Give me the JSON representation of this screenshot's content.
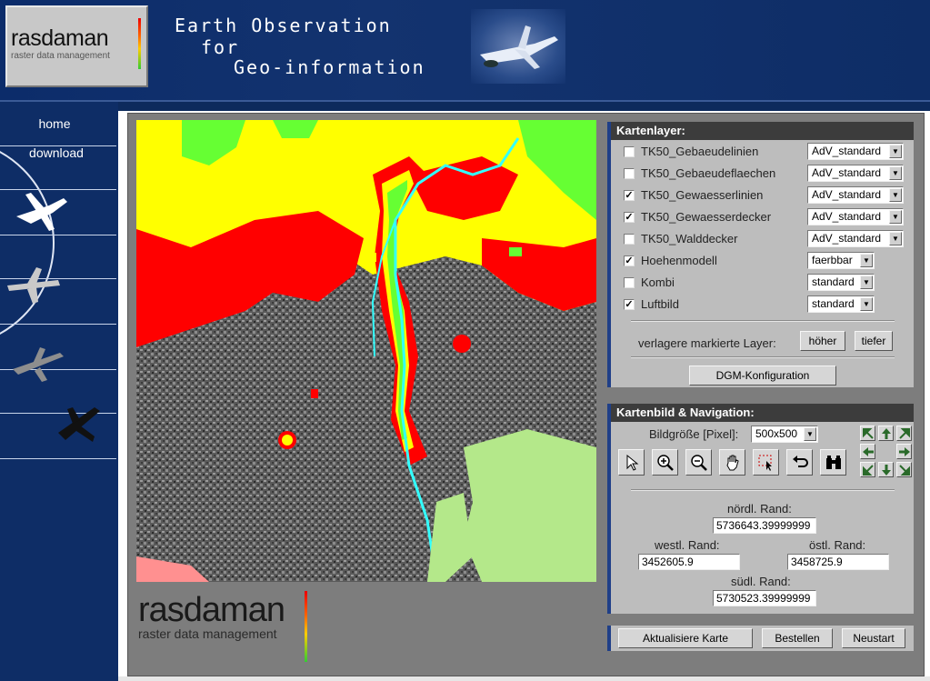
{
  "header": {
    "logo_word": "rasdaman",
    "logo_sub": "raster data management",
    "title_line1": "Earth Observation",
    "title_line2": "for",
    "title_line3": "Geo-information"
  },
  "nav": {
    "home": "home",
    "download": "download"
  },
  "footer_logo": {
    "word": "rasdaman",
    "sub": "raster data management"
  },
  "layers_panel": {
    "title": "Kartenlayer:",
    "layers": [
      {
        "label": "TK50_Gebaeudelinien",
        "checked": false,
        "style": "AdV_standard"
      },
      {
        "label": "TK50_Gebaeudeflaechen",
        "checked": false,
        "style": "AdV_standard"
      },
      {
        "label": "TK50_Gewaesserlinien",
        "checked": true,
        "style": "AdV_standard"
      },
      {
        "label": "TK50_Gewaesserdecker",
        "checked": true,
        "style": "AdV_standard"
      },
      {
        "label": "TK50_Walddecker",
        "checked": false,
        "style": "AdV_standard"
      },
      {
        "label": "Hoehenmodell",
        "checked": true,
        "style": "faerbbar"
      },
      {
        "label": "Kombi",
        "checked": false,
        "style": "standard"
      },
      {
        "label": "Luftbild",
        "checked": true,
        "style": "standard"
      }
    ],
    "move_label": "verlagere markierte Layer:",
    "higher": "höher",
    "lower": "tiefer",
    "dgm_button": "DGM-Konfiguration"
  },
  "nav_panel": {
    "title": "Kartenbild & Navigation:",
    "size_label": "Bildgröße [Pixel]:",
    "size_value": "500x500",
    "north_label": "nördl. Rand:",
    "north_value": "5736643.39999999",
    "west_label": "westl. Rand:",
    "west_value": "3452605.9",
    "east_label": "östl. Rand:",
    "east_value": "3458725.9",
    "south_label": "südl. Rand:",
    "south_value": "5730523.39999999"
  },
  "actions": {
    "update": "Aktualisiere Karte",
    "order": "Bestellen",
    "restart": "Neustart"
  },
  "colors": {
    "header_bg": "#13336f",
    "panel_title_bg": "#3c3c3c",
    "panel_bg": "#bdbdbd",
    "map_red": "#ff0000",
    "map_yellow": "#ffff00",
    "map_green": "#66ff33",
    "map_cyan": "#33ffff"
  }
}
